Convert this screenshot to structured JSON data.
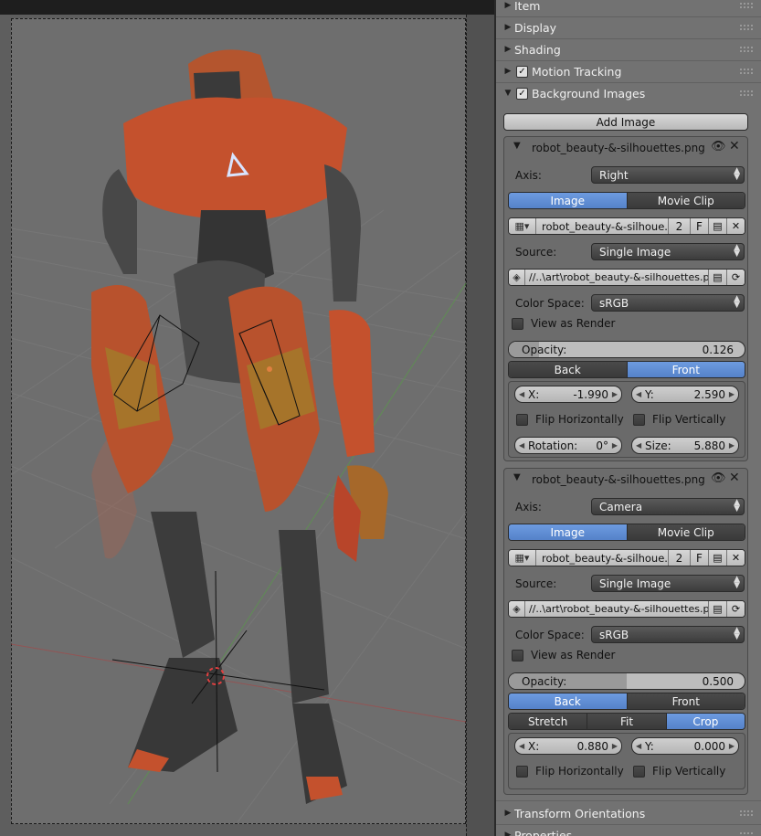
{
  "panel": {
    "sections": [
      {
        "label": "Item"
      },
      {
        "label": "Display"
      },
      {
        "label": "Shading"
      },
      {
        "label": "Motion Tracking",
        "checked": true
      },
      {
        "label": "Background Images",
        "checked": true,
        "expanded": true
      },
      {
        "label": "Transform Orientations"
      },
      {
        "label": "Properties"
      }
    ],
    "add_image_label": "Add Image",
    "images": [
      {
        "filename": "robot_beauty-&-silhouettes.png",
        "axis_label": "Axis:",
        "axis_value": "Right",
        "source_tabs": [
          "Image",
          "Movie Clip"
        ],
        "source_active": "Image",
        "datablock_name": "robot_beauty-&-silhoue...",
        "datablock_users": "2",
        "fake_user": "F",
        "source_label": "Source:",
        "source_value": "Single Image",
        "filepath": "//..\\art\\robot_beauty-&-silhouettes.png",
        "colorspace_label": "Color Space:",
        "colorspace_value": "sRGB",
        "view_as_render_label": "View as Render",
        "view_as_render": false,
        "opacity_label": "Opacity:",
        "opacity_value": "0.126",
        "opacity": 0.126,
        "depth_tabs": [
          "Back",
          "Front"
        ],
        "depth_active": "Front",
        "x_label": "X:",
        "x_value": "-1.990",
        "y_label": "Y:",
        "y_value": "2.590",
        "flip_h_label": "Flip Horizontally",
        "flip_v_label": "Flip Vertically",
        "rotation_label": "Rotation:",
        "rotation_value": "0°",
        "size_label": "Size:",
        "size_value": "5.880"
      },
      {
        "filename": "robot_beauty-&-silhouettes.png",
        "axis_label": "Axis:",
        "axis_value": "Camera",
        "source_tabs": [
          "Image",
          "Movie Clip"
        ],
        "source_active": "Image",
        "datablock_name": "robot_beauty-&-silhoue...",
        "datablock_users": "2",
        "fake_user": "F",
        "source_label": "Source:",
        "source_value": "Single Image",
        "filepath": "//..\\art\\robot_beauty-&-silhouettes.png",
        "colorspace_label": "Color Space:",
        "colorspace_value": "sRGB",
        "view_as_render_label": "View as Render",
        "view_as_render": false,
        "opacity_label": "Opacity:",
        "opacity_value": "0.500",
        "opacity": 0.5,
        "depth_tabs": [
          "Back",
          "Front"
        ],
        "depth_active": "Back",
        "frame_tabs": [
          "Stretch",
          "Fit",
          "Crop"
        ],
        "frame_active": "Crop",
        "x_label": "X:",
        "x_value": "0.880",
        "y_label": "Y:",
        "y_value": "0.000",
        "flip_h_label": "Flip Horizontally",
        "flip_v_label": "Flip Vertically"
      }
    ]
  },
  "colors": {
    "panel_bg": "#727272",
    "active_blue": "#5f8fd6",
    "viewport_bg": "#5e5e5e"
  }
}
